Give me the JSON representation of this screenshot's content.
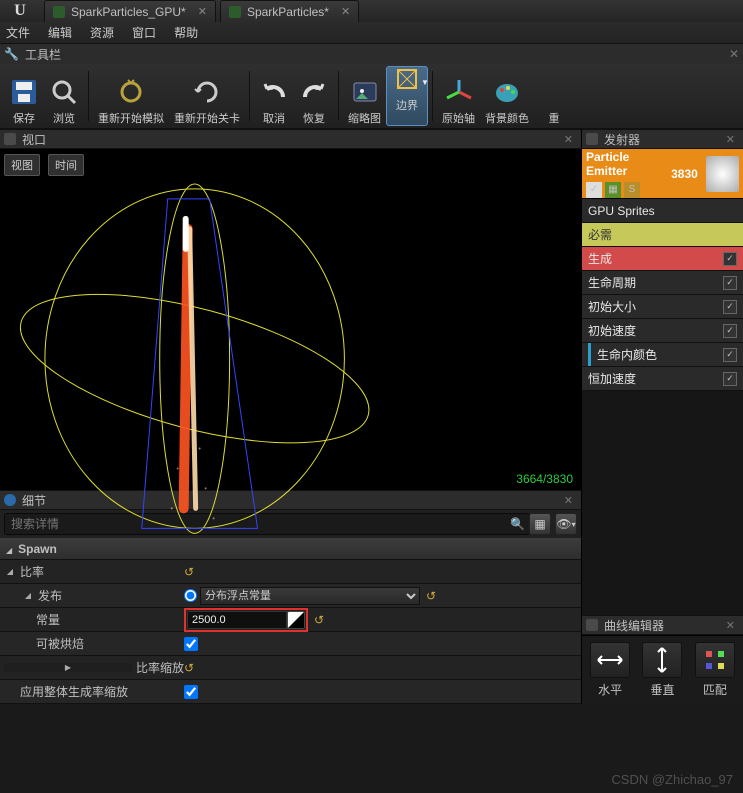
{
  "tabs": {
    "a": "SparkParticles_GPU*",
    "b": "SparkParticles*"
  },
  "menu": {
    "file": "文件",
    "edit": "编辑",
    "asset": "资源",
    "window": "窗口",
    "help": "帮助"
  },
  "toolbar_title": "工具栏",
  "toolbar": {
    "save": "保存",
    "browse": "浏览",
    "resim": "重新开始模拟",
    "relevel": "重新开始关卡",
    "undo": "取消",
    "redo": "恢复",
    "thumb": "缩略图",
    "bounds": "边界",
    "origin": "原始轴",
    "bgcolor": "背景颜色",
    "more": "重"
  },
  "viewport": {
    "panel": "视口",
    "btn_view": "视图",
    "btn_time": "时间",
    "count": "3664/3830"
  },
  "details": {
    "panel": "细节",
    "search_placeholder": "搜索详情",
    "cat_spawn": "Spawn",
    "rate": "比率",
    "dist": "发布",
    "dist_type": "分布浮点常量",
    "constant": "常量",
    "constant_val": "2500.0",
    "bake": "可被烘焙",
    "rate_scale": "比率缩放",
    "use_global": "应用整体生成率缩放"
  },
  "emitters": {
    "panel": "发射器",
    "name": "Particle Emitter",
    "count": "3830",
    "typemod": "GPU Sprites",
    "required": "必需",
    "spawn": "生成",
    "lifetime": "生命周期",
    "initsize": "初始大小",
    "initvel": "初始速度",
    "colorlife": "生命内颜色",
    "constaccel": "恒加速度"
  },
  "curve": {
    "panel": "曲线编辑器",
    "h": "水平",
    "v": "垂直",
    "f": "匹配"
  },
  "watermark": "CSDN @Zhichao_97"
}
